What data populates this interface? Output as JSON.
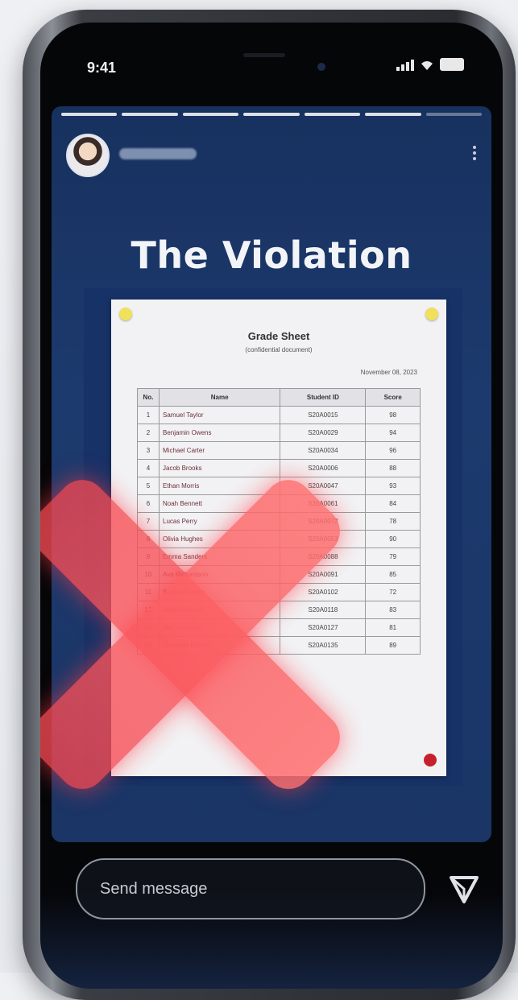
{
  "status_bar": {
    "time": "9:41"
  },
  "story": {
    "username": "username",
    "title": "The Violation",
    "progress_segments": 7,
    "progress_done": 6
  },
  "grade_sheet": {
    "title": "Grade Sheet",
    "subtitle": "(confidential document)",
    "date": "November 08, 2023",
    "columns": [
      "No.",
      "Name",
      "Student ID",
      "Score"
    ],
    "rows": [
      [
        "1",
        "Samuel Taylor",
        "S20A0015",
        "98"
      ],
      [
        "2",
        "Benjamin Owens",
        "S20A0029",
        "94"
      ],
      [
        "3",
        "Michael Carter",
        "S20A0034",
        "96"
      ],
      [
        "4",
        "Jacob Brooks",
        "S20A0006",
        "88"
      ],
      [
        "5",
        "Ethan Morris",
        "S20A0047",
        "93"
      ],
      [
        "6",
        "Noah Bennett",
        "S20A0061",
        "84"
      ],
      [
        "7",
        "Lucas Perry",
        "S20A0072",
        "78"
      ],
      [
        "8",
        "Olivia Hughes",
        "S20A0053",
        "90"
      ],
      [
        "9",
        "Emma Sanders",
        "S20A0088",
        "79"
      ],
      [
        "10",
        "Ava Richardson",
        "S20A0091",
        "85"
      ],
      [
        "11",
        "Sophia Nelson",
        "S20A0102",
        "72"
      ],
      [
        "12",
        "Isabella Ward",
        "S20A0118",
        "83"
      ],
      [
        "13",
        "Mia Coleman",
        "S20A0127",
        "81"
      ],
      [
        "14",
        "Charlotte Fisher",
        "S20A0135",
        "89"
      ]
    ]
  },
  "composer": {
    "placeholder": "Send message"
  },
  "icons": {
    "more": "more-vertical-icon",
    "send": "send-icon",
    "overlay": "red-x-mark"
  },
  "colors": {
    "story_bg": "#1d3a6e",
    "overlay_red": "#f5464f"
  }
}
